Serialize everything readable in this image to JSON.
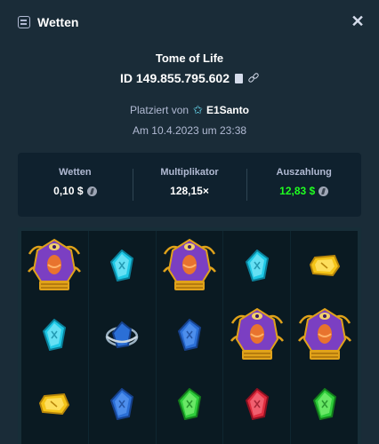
{
  "header": {
    "title": "Wetten"
  },
  "game": {
    "title": "Tome of Life",
    "id": "ID 149.855.795.602",
    "placed_by_prefix": "Platziert von",
    "user": "E1Santo",
    "date": "Am 10.4.2023 um 23:38"
  },
  "stats": {
    "bet_label": "Wetten",
    "bet_value": "0,10 $",
    "multiplier_label": "Multiplikator",
    "multiplier_value": "128,15×",
    "payout_label": "Auszahlung",
    "payout_value": "12,83 $"
  },
  "colors": {
    "accent_green": "#1fff20",
    "bg": "#1a2c38",
    "panel": "#0f212e"
  },
  "board": {
    "columns": [
      [
        "pharaoh-symbol",
        "cyan-gem-symbol",
        "yellow-gem-symbol"
      ],
      [
        "cyan-gem-symbol",
        "blue-orb-symbol",
        "blue-gem-symbol"
      ],
      [
        "pharaoh-symbol",
        "blue-gem-symbol",
        "green-gem-symbol"
      ],
      [
        "cyan-gem-symbol",
        "pharaoh-symbol",
        "red-gem-symbol"
      ],
      [
        "yellow-gem-symbol",
        "pharaoh-symbol",
        "green-gem-symbol"
      ]
    ]
  }
}
